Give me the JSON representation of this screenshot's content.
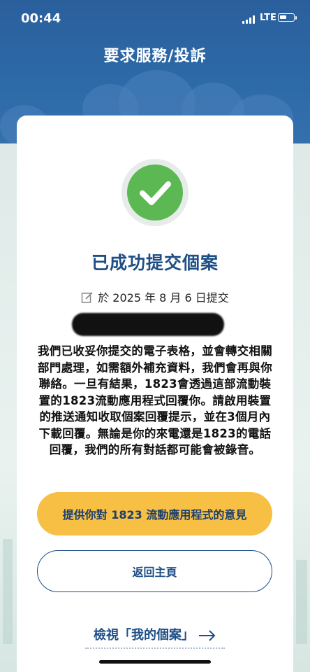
{
  "status_bar": {
    "time": "00:44",
    "network": "LTE",
    "battery_level": 0.5
  },
  "header": {
    "title": "要求服務/投訴"
  },
  "result": {
    "title": "已成功提交個案",
    "date_text": "於 2025 年 8 月 6 日提交",
    "message": "我們已收妥你提交的電子表格，並會轉交相關部門處理，如需額外補充資料，我們會再與你聯絡。一旦有結果，1823會透過這部流動裝置的1823流動應用程式回覆你。請啟用裝置的推送通知收取個案回覆提示，並在3個月內下載回覆。無論是你的來電還是1823的電話回覆，我們的所有對話都可能會被錄音。"
  },
  "buttons": {
    "feedback": "提供你對 1823 流動應用程式的意見",
    "home": "返回主頁"
  },
  "link": {
    "my_cases": "檢視「我的個案」"
  },
  "colors": {
    "primary": "#1e4e86",
    "accent": "#f7bf43",
    "success": "#5bb852",
    "header_bg": "#2d6aa8"
  }
}
